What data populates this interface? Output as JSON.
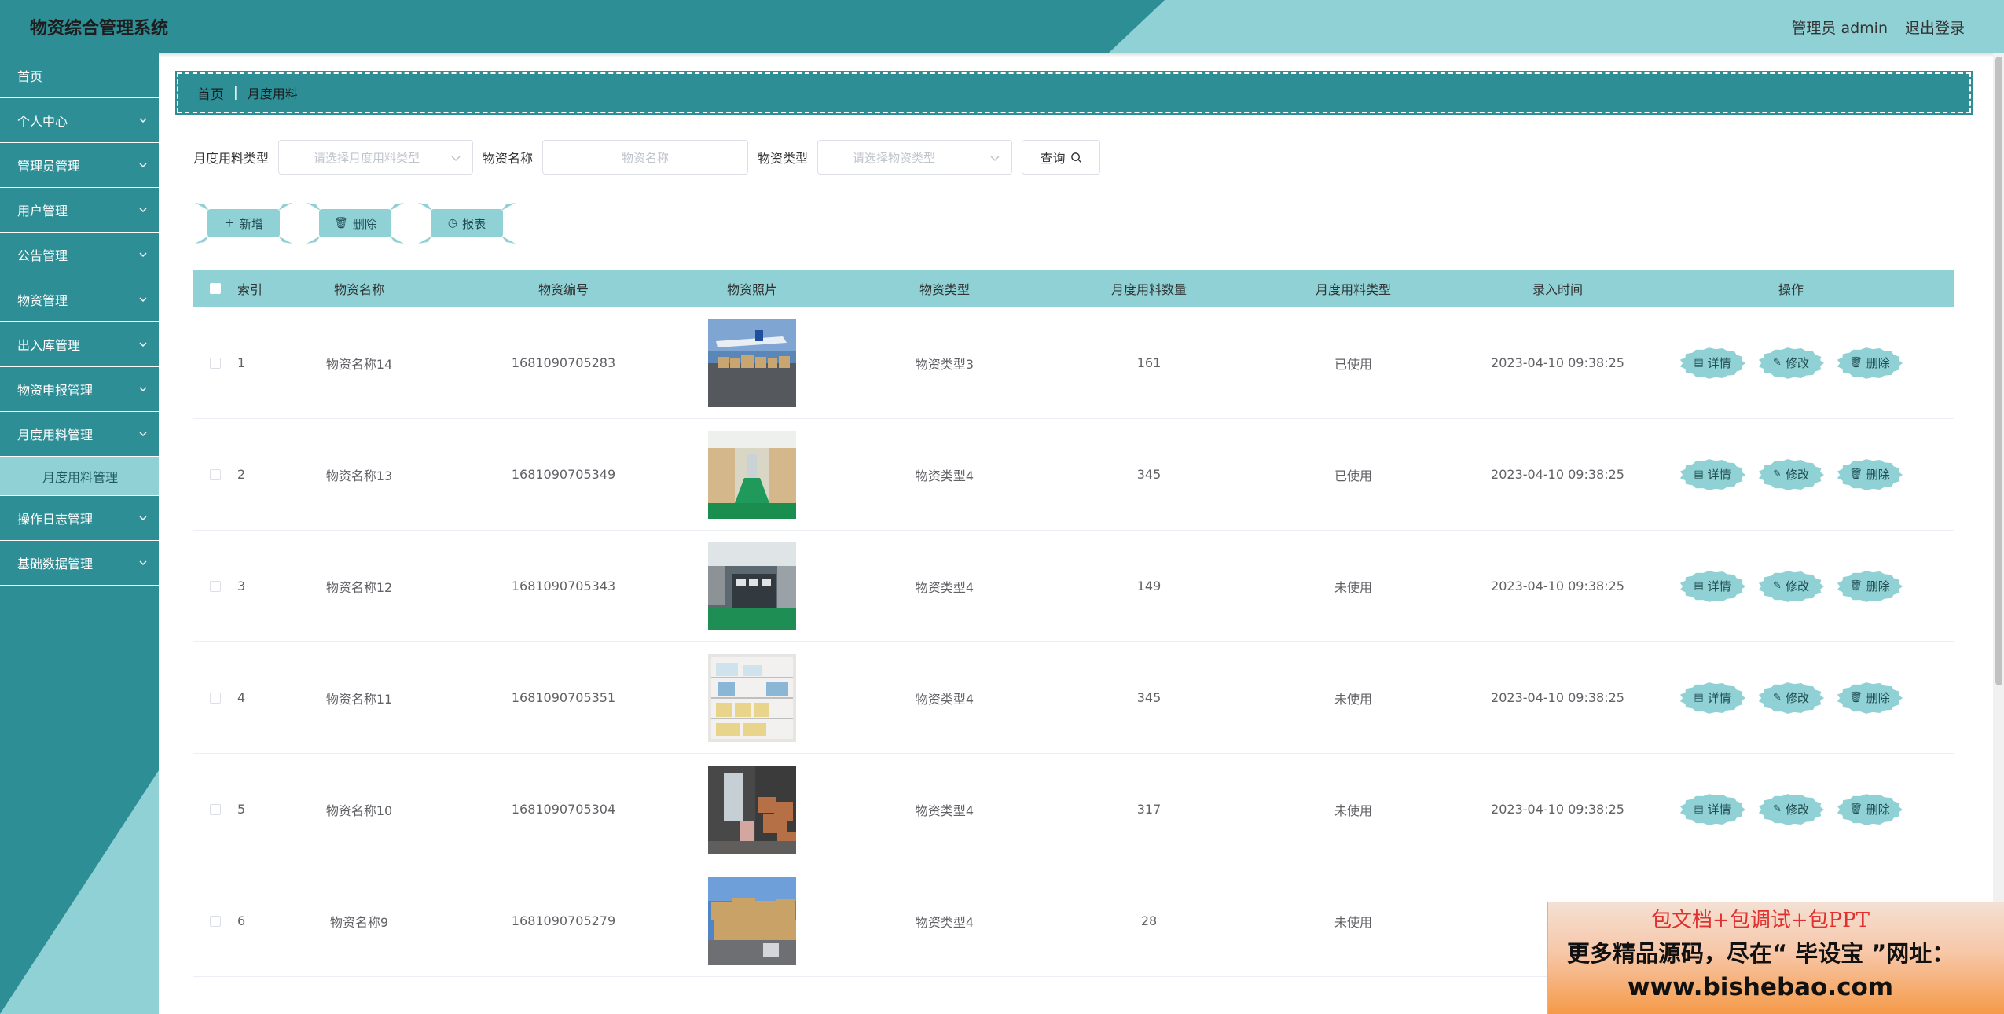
{
  "header": {
    "title": "物资综合管理系统",
    "user": "管理员 admin",
    "logout": "退出登录"
  },
  "sidebar": {
    "items": [
      {
        "label": "首页",
        "expandable": false
      },
      {
        "label": "个人中心",
        "expandable": true
      },
      {
        "label": "管理员管理",
        "expandable": true
      },
      {
        "label": "用户管理",
        "expandable": true
      },
      {
        "label": "公告管理",
        "expandable": true
      },
      {
        "label": "物资管理",
        "expandable": true
      },
      {
        "label": "出入库管理",
        "expandable": true
      },
      {
        "label": "物资申报管理",
        "expandable": true
      },
      {
        "label": "月度用料管理",
        "expandable": true
      },
      {
        "label": "操作日志管理",
        "expandable": true
      },
      {
        "label": "基础数据管理",
        "expandable": true
      }
    ],
    "active_sub": "月度用料管理"
  },
  "breadcrumb": {
    "home": "首页",
    "separator": "|",
    "current": "月度用料"
  },
  "search": {
    "type_label": "月度用料类型",
    "type_placeholder": "请选择月度用料类型",
    "name_label": "物资名称",
    "name_placeholder": "物资名称",
    "category_label": "物资类型",
    "category_placeholder": "请选择物资类型",
    "query_button": "查询"
  },
  "actions": {
    "add": "新增",
    "delete": "删除",
    "report": "报表"
  },
  "table": {
    "columns": [
      "索引",
      "物资名称",
      "物资编号",
      "物资照片",
      "物资类型",
      "月度用料数量",
      "月度用料类型",
      "录入时间",
      "操作"
    ],
    "ops": {
      "detail": "详情",
      "edit": "修改",
      "delete": "删除"
    },
    "rows": [
      {
        "index": "1",
        "name": "物资名称14",
        "code": "1681090705283",
        "photo": "warehouse-photo",
        "type": "物资类型3",
        "qty": "161",
        "mtype": "已使用",
        "time": "2023-04-10 09:38:25"
      },
      {
        "index": "2",
        "name": "物资名称13",
        "code": "1681090705349",
        "photo": "warehouse-photo",
        "type": "物资类型4",
        "qty": "345",
        "mtype": "已使用",
        "time": "2023-04-10 09:38:25"
      },
      {
        "index": "3",
        "name": "物资名称12",
        "code": "1681090705343",
        "photo": "warehouse-photo",
        "type": "物资类型4",
        "qty": "149",
        "mtype": "未使用",
        "time": "2023-04-10 09:38:25"
      },
      {
        "index": "4",
        "name": "物资名称11",
        "code": "1681090705351",
        "photo": "warehouse-photo",
        "type": "物资类型4",
        "qty": "345",
        "mtype": "未使用",
        "time": "2023-04-10 09:38:25"
      },
      {
        "index": "5",
        "name": "物资名称10",
        "code": "1681090705304",
        "photo": "warehouse-photo",
        "type": "物资类型4",
        "qty": "317",
        "mtype": "未使用",
        "time": "2023-04-10 09:38:25"
      },
      {
        "index": "6",
        "name": "物资名称9",
        "code": "1681090705279",
        "photo": "warehouse-photo",
        "type": "物资类型4",
        "qty": "28",
        "mtype": "未使用",
        "time": "202"
      }
    ]
  },
  "watermark": {
    "line1": "包文档+包调试+包PPT",
    "line2": "更多精品源码，尽在“ 毕设宝 ”网址：",
    "line3": "www.bishebao.com"
  },
  "colors": {
    "primary": "#2e8e96",
    "light": "#8fd1d5"
  }
}
